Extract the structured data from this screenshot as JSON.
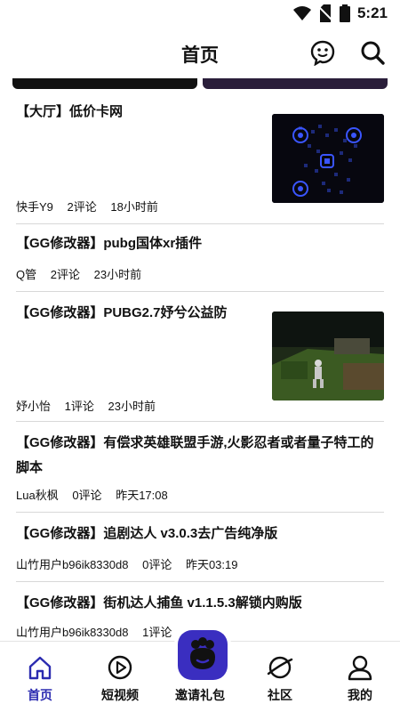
{
  "status": {
    "time": "5:21"
  },
  "header": {
    "title": "首页"
  },
  "posts": [
    {
      "title": "【大厅】低价卡网",
      "author": "快手Y9",
      "comments": "2评论",
      "time": "18小时前"
    },
    {
      "title": "【GG修改器】pubg国体xr插件",
      "author": "Q管",
      "comments": "2评论",
      "time": "23小时前"
    },
    {
      "title": "【GG修改器】PUBG2.7妤兮公益防",
      "author": "妤小怡",
      "comments": "1评论",
      "time": "23小时前"
    },
    {
      "title": "【GG修改器】有偿求英雄联盟手游,火影忍者或者量子特工的脚本",
      "author": "Lua秋枫",
      "comments": "0评论",
      "time": "昨天17:08"
    },
    {
      "title": "【GG修改器】追剧达人 v3.0.3去广告纯净版",
      "author": "山竹用户b96ik8330d8",
      "comments": "0评论",
      "time": "昨天03:19"
    },
    {
      "title": "【GG修改器】街机达人捕鱼 v1.1.5.3解锁内购版",
      "author": "山竹用户b96ik8330d8",
      "comments": "1评论",
      "time": ""
    }
  ],
  "tabs": [
    {
      "label": "首页",
      "icon": "home-icon",
      "active": true
    },
    {
      "label": "短视频",
      "icon": "play-icon"
    },
    {
      "label": "邀请礼包",
      "icon": "gift-icon"
    },
    {
      "label": "社区",
      "icon": "planet-icon"
    },
    {
      "label": "我的",
      "icon": "user-icon"
    }
  ],
  "colors": {
    "accent": "#2b2bb0",
    "invite_bg": "#3a2ec0"
  }
}
